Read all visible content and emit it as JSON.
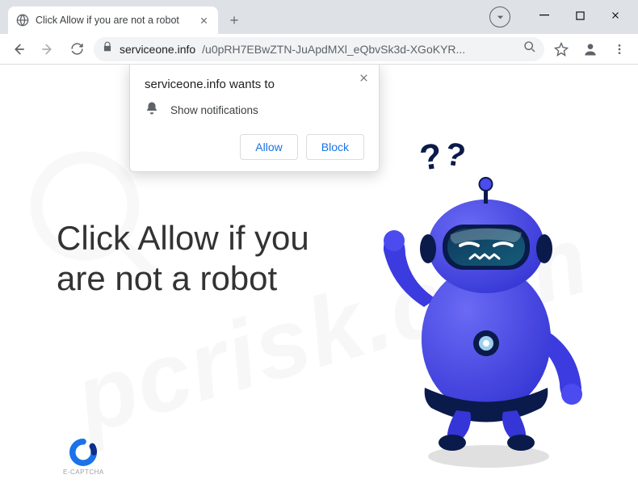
{
  "tab": {
    "title": "Click Allow if you are not a robot"
  },
  "url": {
    "host": "serviceone.info",
    "path": "/u0pRH7EBwZTN-JuApdMXl_eQbvSk3d-XGoKYR..."
  },
  "permission": {
    "origin_label": "serviceone.info wants to",
    "capability_label": "Show notifications",
    "allow_label": "Allow",
    "block_label": "Block"
  },
  "page": {
    "headline": "Click Allow if you are not a robot",
    "captcha_label": "E-CAPTCHA"
  },
  "icons": {
    "globe": "globe-icon",
    "lock": "lock-icon",
    "bell": "bell-icon"
  },
  "watermark": {
    "text": "pcrisk.com"
  }
}
